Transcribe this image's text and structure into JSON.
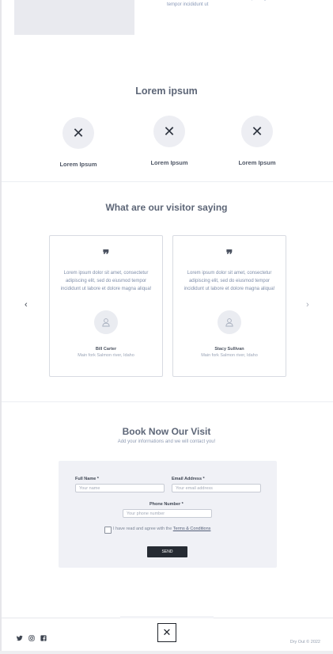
{
  "hero": {
    "text": "incididunt dolor sit amet, consectetur adipiscing elit, sed do eiusmod tempor incididunt ut"
  },
  "features": {
    "title": "Lorem ipsum",
    "items": [
      {
        "label": "Lorem Ipsum",
        "icon": "close-icon"
      },
      {
        "label": "Lorem Ipsum",
        "icon": "close-icon"
      },
      {
        "label": "Lorem Ipsum",
        "icon": "close-icon"
      }
    ]
  },
  "testimonials": {
    "title": "What are our visitor saying",
    "cards": [
      {
        "quote": "❞",
        "text": "Lorem ipsum dolor sit amet, consectetur adipiscing elit, sed do eiusmod tempor incididunt ut labore et dolore magna aliqua!",
        "name": "Bill Carter",
        "location": "Main fork Salmon river, Idaho"
      },
      {
        "quote": "❞",
        "text": "Lorem ipsum dolor sit amet, consectetur adipiscing elit, sed do eiusmod tempor incididunt ut labore et dolore magna aliqua!",
        "name": "Stacy Sullivan",
        "location": "Main fork Salmon river, Idaho"
      }
    ],
    "prev_arrow": "‹",
    "next_arrow": "›"
  },
  "booking": {
    "title": "Book Now Our Visit",
    "subtitle": "Add your informations and we will contact you!",
    "full_name_label": "Full Name *",
    "full_name_placeholder": "Your name",
    "email_label": "Email Address *",
    "email_placeholder": "Your email address",
    "phone_label": "Phone Number *",
    "phone_placeholder": "Your phone number",
    "agree_text": "I have read and agree with the ",
    "terms_text": "Terms & Conditions",
    "send_label": "SEND"
  },
  "footer": {
    "social": [
      "twitter-icon",
      "instagram-icon",
      "facebook-icon"
    ],
    "copyright": "Dry Out © 2022"
  },
  "colors": {
    "accent_dark": "#262b33",
    "panel": "#f0f1f6",
    "muted_text": "#7e8da8"
  }
}
